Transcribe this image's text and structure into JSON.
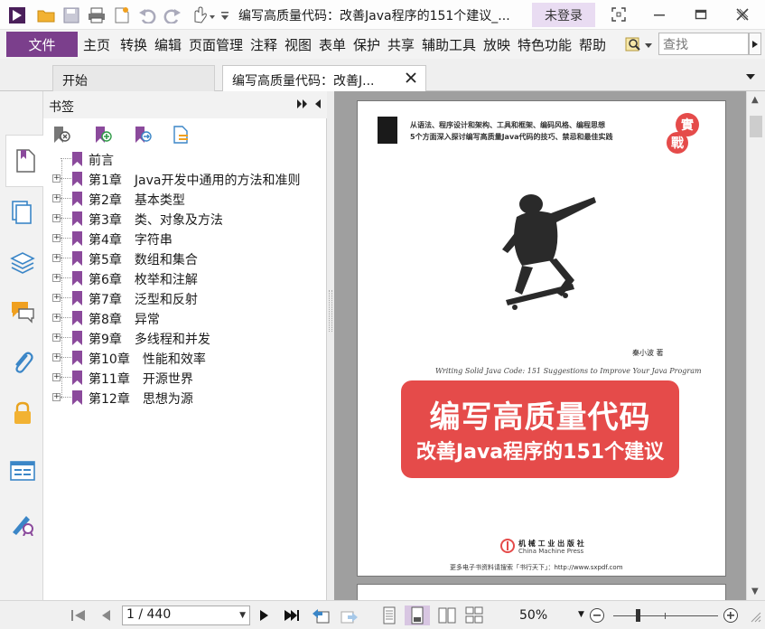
{
  "window": {
    "title": "编写高质量代码：改善Java程序的151个建议_...",
    "login_label": "未登录"
  },
  "colors": {
    "accent": "#7b3f8c",
    "login_bg": "#e9dcf2",
    "banner": "#e54b4a"
  },
  "menu": {
    "file_label": "文件",
    "items": [
      "主页",
      "转换",
      "编辑",
      "页面管理",
      "注释",
      "视图",
      "表单",
      "保护",
      "共享",
      "辅助工具",
      "放映",
      "特色功能",
      "帮助"
    ],
    "search_placeholder": "查找"
  },
  "tabs": [
    {
      "label": "开始"
    },
    {
      "label": "编写高质量代码：改善J..."
    }
  ],
  "bookmarks_panel": {
    "title": "书签",
    "items": [
      {
        "label": "前言"
      },
      {
        "label": "第1章　Java开发中通用的方法和准则"
      },
      {
        "label": "第2章　基本类型"
      },
      {
        "label": "第3章　类、对象及方法"
      },
      {
        "label": "第4章　字符串"
      },
      {
        "label": "第5章　数组和集合"
      },
      {
        "label": "第6章　枚举和注解"
      },
      {
        "label": "第7章　泛型和反射"
      },
      {
        "label": "第8章　异常"
      },
      {
        "label": "第9章　多线程和并发"
      },
      {
        "label": "第10章　性能和效率"
      },
      {
        "label": "第11章　开源世界"
      },
      {
        "label": "第12章　思想为源"
      }
    ]
  },
  "cover": {
    "tagline_1": "从语法、程序设计和架构、工具和框架、编码风格、编程思想",
    "tagline_2": "5个方面深入探讨编写高质量Java代码的技巧、禁忌和最佳实践",
    "seal_1": "實",
    "seal_2": "戰",
    "author": "秦小波  著",
    "english_title": "Writing Solid Java Code: 151 Suggestions to Improve Your Java Program",
    "title_main": "编写高质量代码",
    "title_sub": "改善Java程序的151个建议",
    "publisher_cn": "机 械 工 业 出 版 社",
    "publisher_en": "China Machine Press",
    "footer": "更多电子书资料请搜索「书行天下」：http://www.sxpdf.com"
  },
  "status": {
    "page_display": "1 / 440",
    "zoom": "50%"
  }
}
